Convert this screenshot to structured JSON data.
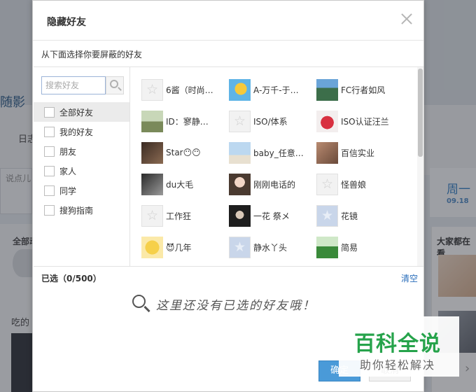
{
  "background": {
    "title": "随影",
    "riji": "日志",
    "input_hint": "说点儿",
    "quanbu": "全部动",
    "chi": "吃的",
    "weekday": "周一",
    "date": "09.18",
    "dajia": "大家都在看"
  },
  "dialog": {
    "title": "隐藏好友",
    "subtitle": "从下面选择你要屏蔽的好友",
    "search_placeholder": "搜索好友",
    "groups": [
      {
        "label": "全部好友",
        "active": true
      },
      {
        "label": "我的好友",
        "active": false
      },
      {
        "label": "朋友",
        "active": false
      },
      {
        "label": "家人",
        "active": false
      },
      {
        "label": "同学",
        "active": false
      },
      {
        "label": "搜狗指南",
        "active": false
      }
    ],
    "friends": [
      {
        "name": "6酱（时尚…",
        "avatar": "default"
      },
      {
        "name": "A-万千-于…",
        "avatar": "fish"
      },
      {
        "name": "FC行者如风",
        "avatar": "landscape"
      },
      {
        "name": "ID：寥静…",
        "avatar": "outdoor"
      },
      {
        "name": "ISO/体系",
        "avatar": "default"
      },
      {
        "name": "ISO认证汪兰",
        "avatar": "red"
      },
      {
        "name": "Star😶😶",
        "avatar": "dark"
      },
      {
        "name": "baby_任意…",
        "avatar": "sky"
      },
      {
        "name": "百信实业",
        "avatar": "brown"
      },
      {
        "name": "du大毛",
        "avatar": "bw"
      },
      {
        "name": "刚刚电话的",
        "avatar": "girl"
      },
      {
        "name": "怪兽娘",
        "avatar": "default"
      },
      {
        "name": "工作狂",
        "avatar": "default"
      },
      {
        "name": "一花 祭メ",
        "avatar": "portrait"
      },
      {
        "name": "花镜",
        "avatar": "default-blue"
      },
      {
        "name": "😈几年",
        "avatar": "cartoon"
      },
      {
        "name": "静水丫头",
        "avatar": "default-blue"
      },
      {
        "name": "简易",
        "avatar": "green"
      }
    ],
    "selected_label": "已选（0/500）",
    "clear_label": "清空",
    "empty_text": "这里还没有已选的好友哦！",
    "ok_label": "确定",
    "cancel_label": "取消"
  },
  "watermark": {
    "main": "百科全说",
    "sub": "助你轻松解决"
  }
}
